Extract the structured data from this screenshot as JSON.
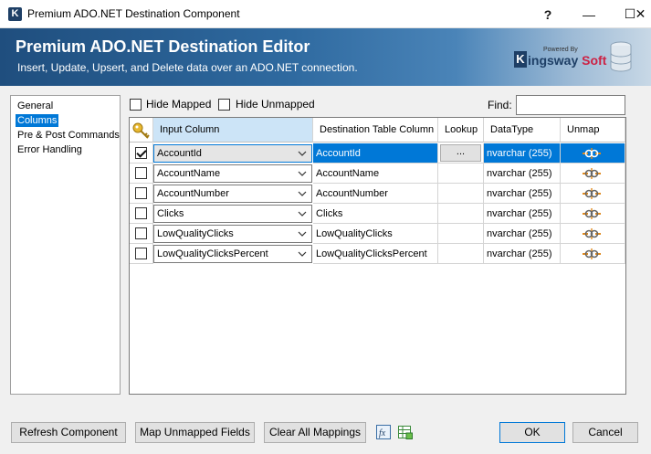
{
  "window": {
    "title": "Premium ADO.NET Destination Component",
    "help_glyph": "?",
    "minimize_glyph": "—",
    "maximize_glyph": "☐",
    "close_glyph": "✕"
  },
  "banner": {
    "title": "Premium ADO.NET Destination Editor",
    "subtitle": "Insert, Update, Upsert, and Delete data over an ADO.NET connection.",
    "logo_powered_by": "Powered By",
    "logo_k": "K",
    "logo_name_main": "ingsway",
    "logo_name_accent": "Soft"
  },
  "sidebar": {
    "items": [
      {
        "label": "General",
        "selected": false
      },
      {
        "label": "Columns",
        "selected": true
      },
      {
        "label": "Pre & Post Commands",
        "selected": false
      },
      {
        "label": "Error Handling",
        "selected": false
      }
    ]
  },
  "options": {
    "hide_mapped_label": "Hide Mapped",
    "hide_unmapped_label": "Hide Unmapped",
    "find_label": "Find:",
    "find_value": ""
  },
  "grid": {
    "headers": {
      "input": "Input Column",
      "dest": "Destination Table Column",
      "lookup": "Lookup",
      "datatype": "DataType",
      "unmap": "Unmap"
    },
    "rows": [
      {
        "checked": true,
        "input": "AccountId",
        "dest": "AccountId",
        "lookup": "...",
        "datatype": "nvarchar (255)",
        "selected": true
      },
      {
        "checked": false,
        "input": "AccountName",
        "dest": "AccountName",
        "lookup": "",
        "datatype": "nvarchar (255)",
        "selected": false
      },
      {
        "checked": false,
        "input": "AccountNumber",
        "dest": "AccountNumber",
        "lookup": "",
        "datatype": "nvarchar (255)",
        "selected": false
      },
      {
        "checked": false,
        "input": "Clicks",
        "dest": "Clicks",
        "lookup": "",
        "datatype": "nvarchar (255)",
        "selected": false
      },
      {
        "checked": false,
        "input": "LowQualityClicks",
        "dest": "LowQualityClicks",
        "lookup": "",
        "datatype": "nvarchar (255)",
        "selected": false
      },
      {
        "checked": false,
        "input": "LowQualityClicksPercent",
        "dest": "LowQualityClicksPercent",
        "lookup": "",
        "datatype": "nvarchar (255)",
        "selected": false
      }
    ]
  },
  "footer": {
    "refresh_label": "Refresh Component",
    "map_unmapped_label": "Map Unmapped Fields",
    "clear_mappings_label": "Clear All Mappings",
    "ok_label": "OK",
    "cancel_label": "Cancel"
  },
  "colors": {
    "selection": "#0078d7",
    "banner_dark": "#1f4e7e",
    "header_highlight": "#cce4f7"
  }
}
